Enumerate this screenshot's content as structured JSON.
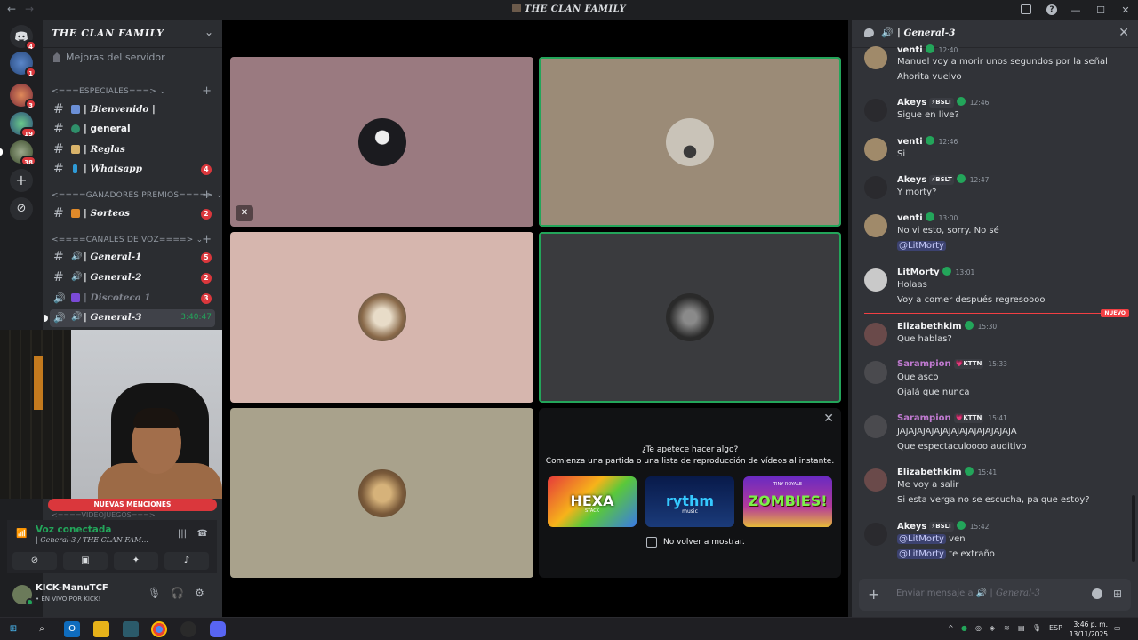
{
  "window": {
    "title": "THE CLAN FAMILY"
  },
  "server": {
    "name": "THE CLAN FAMILY",
    "boost_label": "Mejoras del servidor",
    "rail_badges": [
      "4",
      "1",
      "3",
      "19",
      "38"
    ]
  },
  "categories": {
    "especiales": "<===ESPECIALES===>",
    "ganadores": "<====GANADORES PREMIOS====>",
    "voz": "<====CANALES DE VOZ====>",
    "juegos": "<====VIDEOJUEGOS===>"
  },
  "channels": [
    {
      "name": "| Bienvenido |",
      "badge": ""
    },
    {
      "name": "| general",
      "badge": ""
    },
    {
      "name": "| Reglas",
      "badge": ""
    },
    {
      "name": "| Whatsapp",
      "badge": "4"
    },
    {
      "name": "| Sorteos",
      "badge": "2"
    },
    {
      "name": "| General-1",
      "badge": "5"
    },
    {
      "name": "| General-2",
      "badge": "2"
    },
    {
      "name": "| Discoteca 1",
      "badge": "3"
    },
    {
      "name": "| General-3",
      "timer": "3:40:47"
    }
  ],
  "mentions_banner": "NUEVAS MENCIONES",
  "voice": {
    "status": "Voz conectada",
    "location": "| General-3 / THE CLAN FAM..."
  },
  "user": {
    "name": "KICK-ManuTCF",
    "status": "• EN VIVO POR KICK!"
  },
  "activity": {
    "prompt": "¿Te apetece hacer algo?",
    "desc": "Comienza una partida o una lista de reproducción de vídeos al instante.",
    "games": [
      "HEXA",
      "rythm",
      "ZOMBIES!"
    ],
    "game_sub": [
      "STACK",
      "music",
      "TINY ROYALE"
    ],
    "dont_show": "No volver a mostrar."
  },
  "chat": {
    "channel": "| General-3",
    "new_label": "NUEVO",
    "input_placeholder": "Enviar mensaje a",
    "input_channel": "General-3",
    "messages": [
      {
        "author": "venti",
        "time": "12:40",
        "lines": [
          "Manuel voy a morir unos segundos por la señal",
          "Ahorita vuelvo"
        ]
      },
      {
        "author": "Akeys",
        "tag": "⚡BSLT",
        "time": "12:46",
        "lines": [
          "Sigue en live?"
        ]
      },
      {
        "author": "venti",
        "time": "12:46",
        "lines": [
          "Si"
        ]
      },
      {
        "author": "Akeys",
        "tag": "⚡BSLT",
        "time": "12:47",
        "lines": [
          "Y morty?"
        ]
      },
      {
        "author": "venti",
        "time": "13:00",
        "lines": [
          "No vi esto, sorry. No sé"
        ],
        "mention": "@LitMorty"
      },
      {
        "author": "LitMorty",
        "time": "13:01",
        "lines": [
          "Holaas",
          "Voy a comer después regresoooo"
        ]
      },
      {
        "author": "Elizabethkim",
        "time": "15:30",
        "lines": [
          "Que hablas?"
        ]
      },
      {
        "author": "Sarampion",
        "tag": "💗KTTN",
        "time": "15:33",
        "lines": [
          "Que asco",
          "Ojalá que nunca"
        ]
      },
      {
        "author": "Sarampion",
        "tag": "💗KTTN",
        "time": "15:41",
        "lines": [
          "JAJAJAJAJAJAJAJAJAJAJAJAJAJA",
          "Que espectaculoooo auditivo"
        ]
      },
      {
        "author": "Elizabethkim",
        "time": "15:41",
        "lines": [
          "Me voy a salir",
          "Si esta verga no se escucha, pa que estoy?"
        ]
      },
      {
        "author": "Akeys",
        "tag": "⚡BSLT",
        "time": "15:42",
        "mention_lines": [
          [
            "@LitMorty",
            "ven"
          ],
          [
            "@LitMorty",
            "te extraño"
          ]
        ]
      }
    ]
  },
  "taskbar": {
    "lang": "ESP",
    "time": "3:46 p. m.",
    "date": "13/11/2025"
  },
  "colors": {
    "accent": "#23a55a",
    "danger": "#da373c",
    "mention": "#3c4270"
  }
}
